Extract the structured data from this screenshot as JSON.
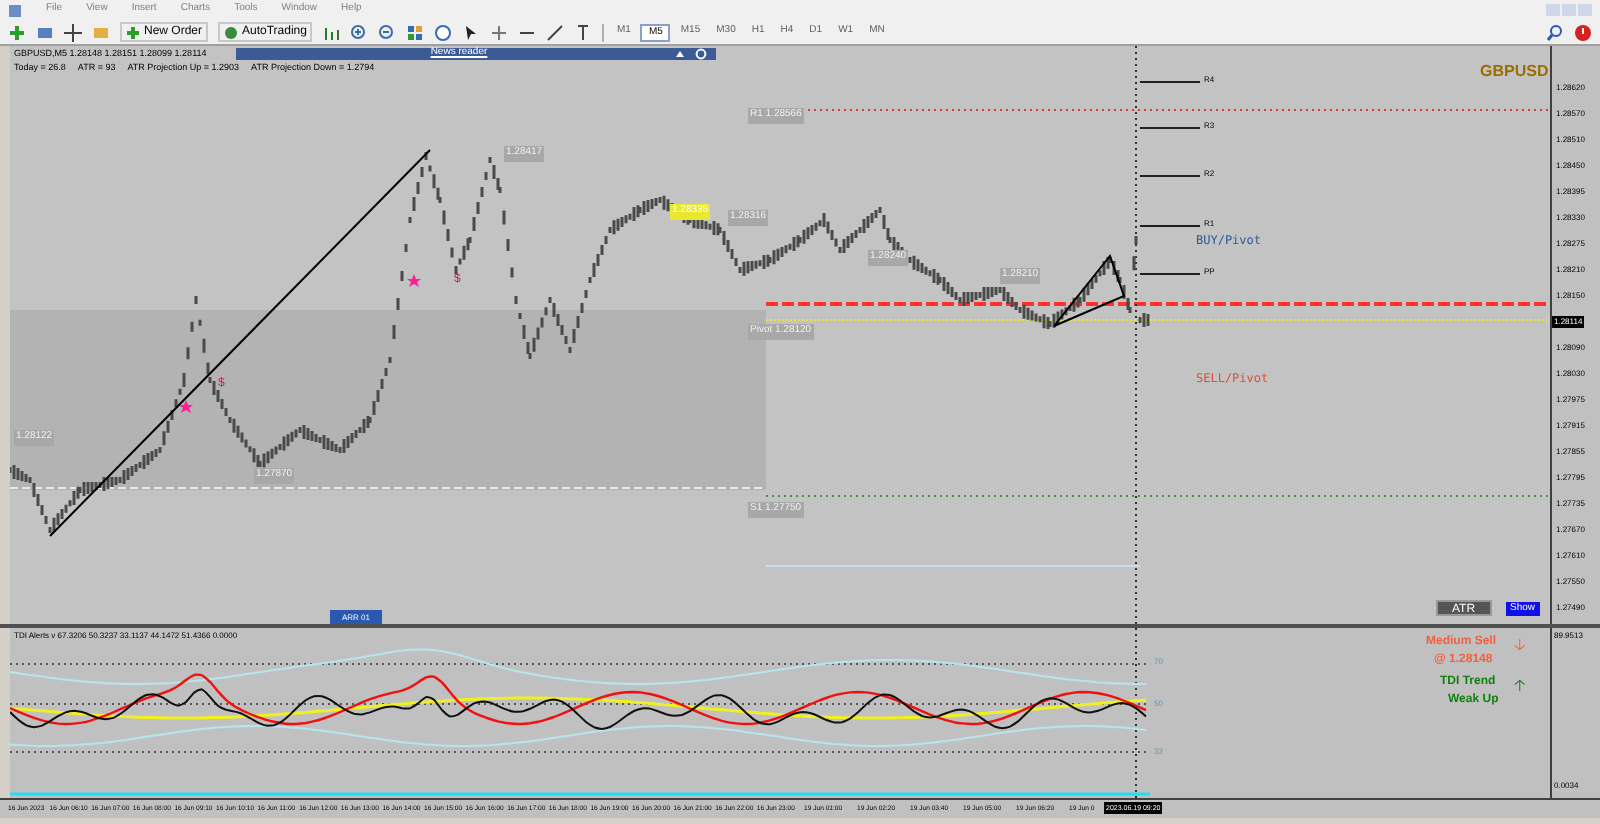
{
  "menu": [
    "File",
    "View",
    "Insert",
    "Charts",
    "Tools",
    "Window",
    "Help"
  ],
  "toolbar": {
    "buttons": [
      {
        "label": "New Order",
        "kind": "order"
      },
      {
        "label": "AutoTrading",
        "kind": "auto"
      }
    ],
    "timeframes": [
      {
        "label": "M1",
        "selected": false
      },
      {
        "label": "M5",
        "selected": true
      },
      {
        "label": "M15",
        "selected": false
      },
      {
        "label": "M30",
        "selected": false
      },
      {
        "label": "H1",
        "selected": false
      },
      {
        "label": "H4",
        "selected": false
      },
      {
        "label": "D1",
        "selected": false
      },
      {
        "label": "W1",
        "selected": false
      },
      {
        "label": "MN",
        "selected": false
      }
    ]
  },
  "chart": {
    "header": "GBPUSD,M5  1.28148 1.28151 1.28099 1.28114",
    "stats": [
      "Today = 26.8",
      "ATR = 93",
      "ATR Projection Up = 1.2903",
      "ATR Projection Down = 1.2794"
    ],
    "news_reader": "News reader",
    "symbol": "GBPUSD",
    "price_tags": [
      {
        "text": "1.28122",
        "kind": "plain"
      },
      {
        "text": "1.27870",
        "kind": "plain"
      },
      {
        "text": "1.28417",
        "kind": "plain"
      },
      {
        "text": "1.28335",
        "kind": "highlight"
      },
      {
        "text": "1.28316",
        "kind": "plain"
      },
      {
        "text": "1.28240",
        "kind": "plain"
      },
      {
        "text": "1.28210",
        "kind": "plain"
      },
      {
        "text": "R1 1.28566",
        "kind": "plain"
      },
      {
        "text": "Pivot 1.28120",
        "kind": "plain"
      },
      {
        "text": "S1 1.27750",
        "kind": "plain"
      }
    ],
    "pivots": [
      "R4",
      "R3",
      "R2",
      "R1",
      "PP"
    ],
    "markers": [
      "$",
      "$"
    ],
    "buy_label": "BUY/Pivot",
    "sell_label": "SELL/Pivot",
    "atr_button": "ATR",
    "show_button": "Show",
    "arr_label": "ARR 01"
  },
  "price_axis": [
    {
      "label": "1.28620",
      "kind": "tick"
    },
    {
      "label": "1.28570",
      "kind": "tick"
    },
    {
      "label": "1.28510",
      "kind": "tick"
    },
    {
      "label": "1.28450",
      "kind": "tick"
    },
    {
      "label": "1.28395",
      "kind": "tick"
    },
    {
      "label": "1.28330",
      "kind": "tick"
    },
    {
      "label": "1.28275",
      "kind": "tick"
    },
    {
      "label": "1.28210",
      "kind": "tick"
    },
    {
      "label": "1.28150",
      "kind": "tick"
    },
    {
      "label": "1.28114",
      "kind": "current"
    },
    {
      "label": "1.28090",
      "kind": "tick"
    },
    {
      "label": "1.28030",
      "kind": "tick"
    },
    {
      "label": "1.27975",
      "kind": "tick"
    },
    {
      "label": "1.27915",
      "kind": "tick"
    },
    {
      "label": "1.27855",
      "kind": "tick"
    },
    {
      "label": "1.27795",
      "kind": "tick"
    },
    {
      "label": "1.27735",
      "kind": "tick"
    },
    {
      "label": "1.27670",
      "kind": "tick"
    },
    {
      "label": "1.27610",
      "kind": "tick"
    },
    {
      "label": "1.27550",
      "kind": "tick"
    },
    {
      "label": "1.27490",
      "kind": "tick"
    }
  ],
  "indicator": {
    "title": "TDI Alerts v 67.3206 50.3237 33.1137 44.1472 51.4366 0.0000",
    "levels": [
      "70",
      "50",
      "32"
    ],
    "signal": {
      "text": "Medium Sell",
      "price": "@ 1.28148",
      "arrow": "🡣",
      "color": "#f06040"
    },
    "trend": {
      "text": "TDI Trend",
      "value": "Weak Up",
      "arrow": "🡡",
      "color": "#108010"
    },
    "axis": [
      "89.9513",
      "0.0034"
    ]
  },
  "time_axis": [
    "16 Jun 2023",
    "16 Jun 06:10",
    "16 Jun 07:00",
    "16 Jun 08:00",
    "16 Jun 09:10",
    "16 Jun 10:10",
    "16 Jun 11:00",
    "16 Jun 12:00",
    "16 Jun 13:00",
    "16 Jun 14:00",
    "16 Jun 15:00",
    "16 Jun 16:00",
    "16 Jun 17:00",
    "16 Jun 18:00",
    "16 Jun 19:00",
    "16 Jun 20:00",
    "16 Jun 21:00",
    "16 Jun 22:00",
    "16 Jun 23:00",
    "19 Jun 01:00",
    "19 Jun 02:20",
    "19 Jun 03:40",
    "19 Jun 05:00",
    "19 Jun 06:20",
    "19 Jun 0"
  ],
  "cursor_time": "2023.06.19 09:20"
}
